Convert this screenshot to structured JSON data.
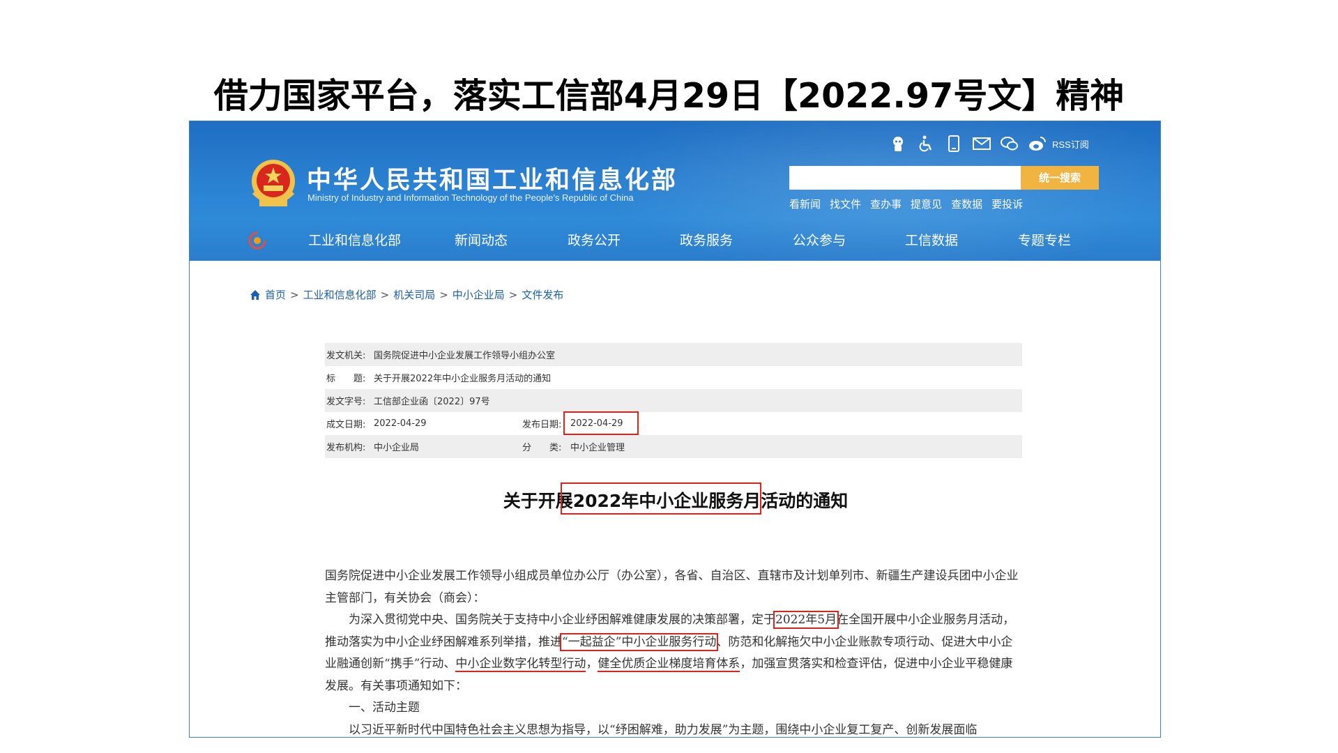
{
  "slide": {
    "title": "借力国家平台，落实工信部4月29日【2022.97号文】精神"
  },
  "site": {
    "name": "中华人民共和国工业和信息化部",
    "name_en": "Ministry of Industry and Information Technology of the People's Republic of China",
    "utility_icons": [
      "robot-icon",
      "accessibility-icon",
      "mobile-icon",
      "mail-icon",
      "wechat-icon",
      "weibo-icon"
    ],
    "rss_label": "RSS订阅",
    "search": {
      "value": "",
      "button_label": "统一搜索"
    },
    "quick_links": [
      "看新闻",
      "找文件",
      "查办事",
      "提意见",
      "查数据",
      "要投诉"
    ],
    "nav": [
      "工业和信息化部",
      "新闻动态",
      "政务公开",
      "政务服务",
      "公众参与",
      "工信数据",
      "专题专栏"
    ],
    "header_color": "#2a7fd0",
    "accent_color": "#f2b441"
  },
  "breadcrumb": [
    "首页",
    "工业和信息化部",
    "机关司局",
    "中小企业局",
    "文件发布"
  ],
  "meta": {
    "issuer_label": "发文机关:",
    "issuer": "国务院促进中小企业发展工作领导小组办公室",
    "title_label": "标　　题:",
    "title": "关于开展2022年中小企业服务月活动的通知",
    "number_label": "发文字号:",
    "number": "工信部企业函〔2022〕97号",
    "created_label": "成文日期:",
    "created": "2022-04-29",
    "published_label": "发布日期:",
    "published": "2022-04-29",
    "org_label": "发布机构:",
    "org": "中小企业局",
    "category_label": "分　　类:",
    "category": "中小企业管理"
  },
  "doc": {
    "title": "关于开展2022年中小企业服务月活动的通知",
    "p1": "国务院促进中小企业发展工作领导小组成员单位办公厅（办公室），各省、自治区、直辖市及计划单列市、新疆生产建设兵团中小企业主管部门，有关协会（商会）：",
    "p2_a": "为深入贯彻党中央、国务院关于支持中小企业纾困解难健康发展的决策部署，定于",
    "p2_b": "2022年5月",
    "p2_c": "在全国开展中小企业服务月活动，推动落实为中小企业纾困解难系列举措，推进",
    "p2_d": "“一起益企”中小企业服务行动",
    "p2_e": "、防范和化解拖欠中小企业账款专项行动、促进大中小企业融通创新“携手”行动、",
    "p2_f": "中小企业数字化转型行动",
    "p2_g": "，",
    "p2_h": "健全优质企业梯度培育体系",
    "p2_i": "，加强宣贯落实和检查评估，促进中小企业平稳健康发展。有关事项通知如下：",
    "p3": "一、活动主题",
    "p4_a": "以习近平新时代中国特色社会主义思想为指导，以",
    "p4_b": "“纾困解难，助力发展”",
    "p4_c": "为主题，围绕",
    "p4_d": "中小企业复工复产",
    "p4_e": "、",
    "p4_f": "创新发展",
    "p4_g": "面临"
  }
}
